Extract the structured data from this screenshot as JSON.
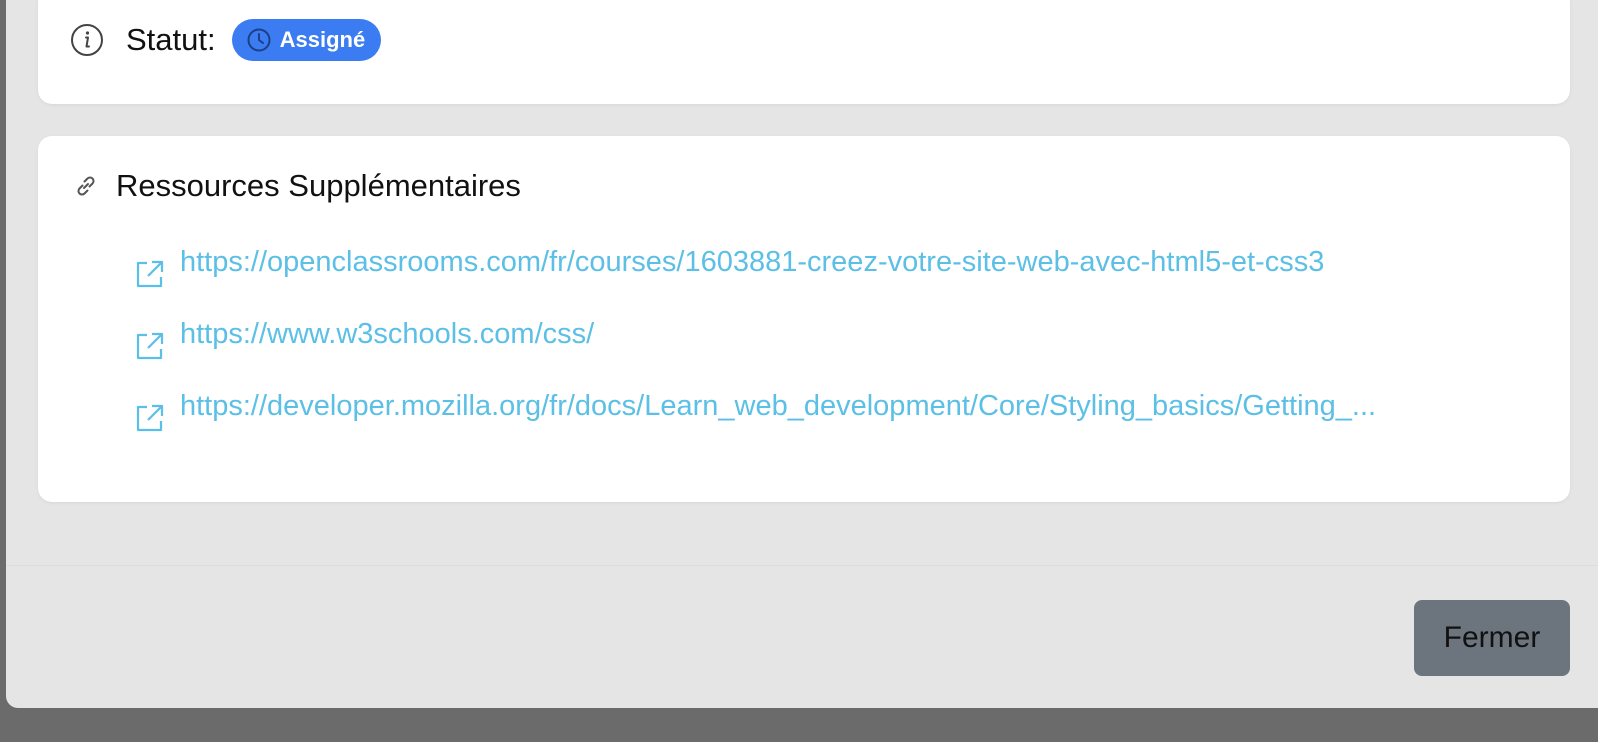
{
  "status_card": {
    "label": "Statut:",
    "badge_text": "Assigné",
    "badge_color": "#3b7cf2"
  },
  "resources": {
    "title": "Ressources Supplémentaires",
    "links": [
      {
        "url": "https://openclassrooms.com/fr/courses/1603881-creez-votre-site-web-avec-html5-et-css3"
      },
      {
        "url": "https://www.w3schools.com/css/"
      },
      {
        "url": "https://developer.mozilla.org/fr/docs/Learn_web_development/Core/Styling_basics/Getting_..."
      }
    ],
    "link_color": "#5bbfe6"
  },
  "footer": {
    "close_label": "Fermer"
  },
  "icons": {
    "info": "info-icon",
    "clock": "clock-icon",
    "link": "link-icon",
    "external": "external-link-icon"
  }
}
